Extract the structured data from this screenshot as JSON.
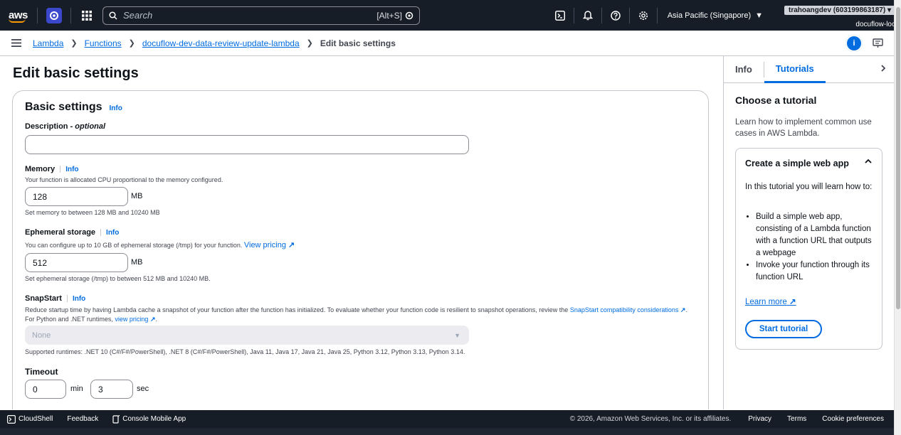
{
  "topnav": {
    "logo": "aws",
    "search_placeholder": "Search",
    "search_shortcut": "[Alt+S]",
    "region": "Asia Pacific (Singapore)",
    "account_user": "trahoangdev (603199863187)",
    "account_role": "docuflow-loc"
  },
  "breadcrumb": {
    "items": [
      "Lambda",
      "Functions",
      "docuflow-dev-data-review-update-lambda"
    ],
    "current": "Edit basic settings"
  },
  "page": {
    "title": "Edit basic settings",
    "section_title": "Basic settings",
    "info_label": "Info"
  },
  "form": {
    "description": {
      "label": "Description",
      "optional": "optional",
      "value": ""
    },
    "memory": {
      "label": "Memory",
      "help": "Your function is allocated CPU proportional to the memory configured.",
      "value": "128",
      "unit": "MB",
      "constraint": "Set memory to between 128 MB and 10240 MB"
    },
    "ephemeral": {
      "label": "Ephemeral storage",
      "help": "You can configure up to 10 GB of ephemeral storage (/tmp) for your function.",
      "pricing_link": "View pricing",
      "value": "512",
      "unit": "MB",
      "constraint": "Set ephemeral storage (/tmp) to between 512 MB and 10240 MB."
    },
    "snapstart": {
      "label": "SnapStart",
      "help_prefix": "Reduce startup time by having Lambda cache a snapshot of your function after the function has initialized. To evaluate whether your function code is resilient to snapshot operations, review the",
      "help_link": "SnapStart compatibility considerations",
      "help_mid": ". For Python and .NET runtimes,",
      "pricing_link": "view pricing",
      "help_end": ".",
      "selected": "None",
      "runtimes": "Supported runtimes: .NET 10 (C#/F#/PowerShell), .NET 8 (C#/F#/PowerShell), Java 11, Java 17, Java 21, Java 25, Python 3.12, Python 3.13, Python 3.14."
    },
    "timeout": {
      "label": "Timeout",
      "min_value": "0",
      "min_unit": "min",
      "sec_value": "3",
      "sec_unit": "sec"
    }
  },
  "side_panel": {
    "tabs": [
      "Info",
      "Tutorials"
    ],
    "active_tab": "Tutorials",
    "heading": "Choose a tutorial",
    "intro": "Learn how to implement common use cases in AWS Lambda.",
    "tutorial": {
      "title": "Create a simple web app",
      "text": "In this tutorial you will learn how to:",
      "bullets": [
        "Build a simple web app, consisting of a Lambda function with a function URL that outputs a webpage",
        "Invoke your function through its function URL"
      ],
      "learn_more": "Learn more",
      "start_button": "Start tutorial"
    }
  },
  "footer": {
    "cloudshell": "CloudShell",
    "feedback": "Feedback",
    "mobile_app": "Console Mobile App",
    "copyright": "© 2026, Amazon Web Services, Inc. or its affiliates.",
    "privacy": "Privacy",
    "terms": "Terms",
    "cookies": "Cookie preferences"
  },
  "colors": {
    "nav_bg": "#161d26",
    "link": "#006ce0",
    "accent_orange": "#ff9900"
  }
}
